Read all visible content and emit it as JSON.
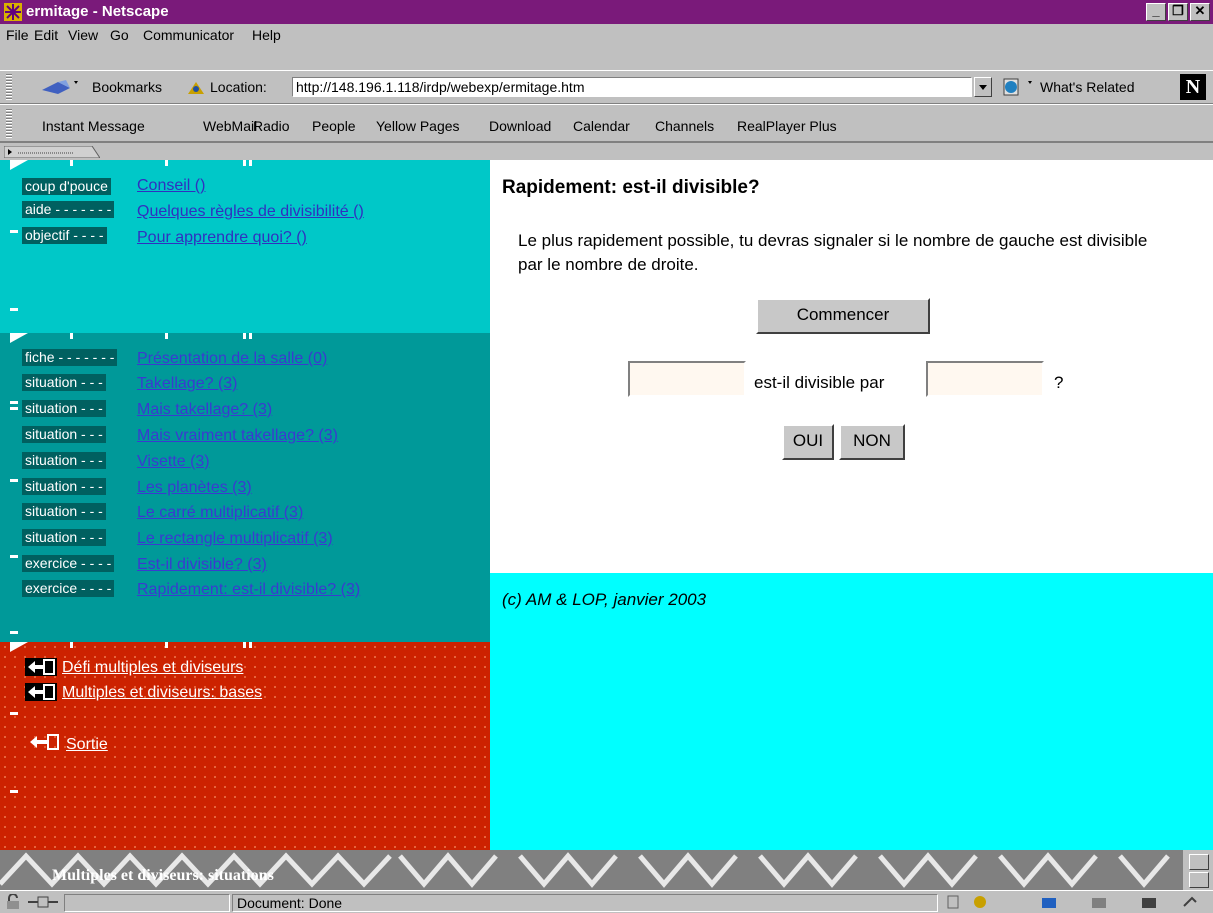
{
  "window": {
    "title": "ermitage - Netscape"
  },
  "menu": [
    "File",
    "Edit",
    "View",
    "Go",
    "Communicator",
    "Help"
  ],
  "nav_toolbar": {
    "bookmarks_label": "Bookmarks",
    "location_label": "Location:",
    "location_url": "http://148.196.1.118/irdp/webexp/ermitage.htm",
    "whats_related_label": "What's Related"
  },
  "personal_toolbar": [
    "Instant Message",
    "WebMail",
    "Radio",
    "People",
    "Yellow Pages",
    "Download",
    "Calendar",
    "Channels",
    "RealPlayer Plus"
  ],
  "left_top": {
    "items": [
      {
        "tag": "coup d'pouce",
        "link": "Conseil ()"
      },
      {
        "tag": "aide - - - - - - -",
        "link": "Quelques règles de divisibilité ()"
      },
      {
        "tag": "objectif - - - -",
        "link": "Pour apprendre quoi? ()"
      }
    ]
  },
  "left_mid": {
    "items": [
      {
        "tag": "fiche - - - - - - -",
        "link": "Présentation de la salle (0)"
      },
      {
        "tag": "situation - - -",
        "link": "Takellage? (3)"
      },
      {
        "tag": "situation - - -",
        "link": "Mais takellage? (3)"
      },
      {
        "tag": "situation - - -",
        "link": "Mais vraiment takellage? (3)"
      },
      {
        "tag": "situation - - -",
        "link": "Visette (3)"
      },
      {
        "tag": "situation - - -",
        "link": "Les planètes (3)"
      },
      {
        "tag": "situation - - -",
        "link": "Le carré multiplicatif (3)"
      },
      {
        "tag": "situation - - -",
        "link": "Le rectangle multiplicatif (3)"
      },
      {
        "tag": "exercice - - - -",
        "link": "Est-il divisible? (3)"
      },
      {
        "tag": "exercice - - - -",
        "link": "Rapidement: est-il divisible? (3)"
      }
    ]
  },
  "left_bot": {
    "links": [
      "Défi multiples et diviseurs",
      "Multiples et diviseurs: bases",
      "Sortie"
    ]
  },
  "main": {
    "title": "Rapidement: est-il divisible?",
    "instruction": "Le plus rapidement possible, tu devras signaler si le nombre de gauche est divisible par le nombre de droite.",
    "start_button": "Commencer",
    "question_mid": "est-il divisible par",
    "question_end": "?",
    "left_number": "",
    "right_number": "",
    "yes_button": "OUI",
    "no_button": "NON"
  },
  "footer": {
    "copyright": "(c) AM & LOP, janvier 2003"
  },
  "banner": {
    "title": "Multiples et diviseurs: situations"
  },
  "status": {
    "text": "Document: Done"
  },
  "colors": {
    "titlebar": "#7a1a7a",
    "left_top": "#00c8c8",
    "left_mid": "#009999",
    "left_bot": "#cc2200",
    "right_foot": "#00ffff"
  }
}
